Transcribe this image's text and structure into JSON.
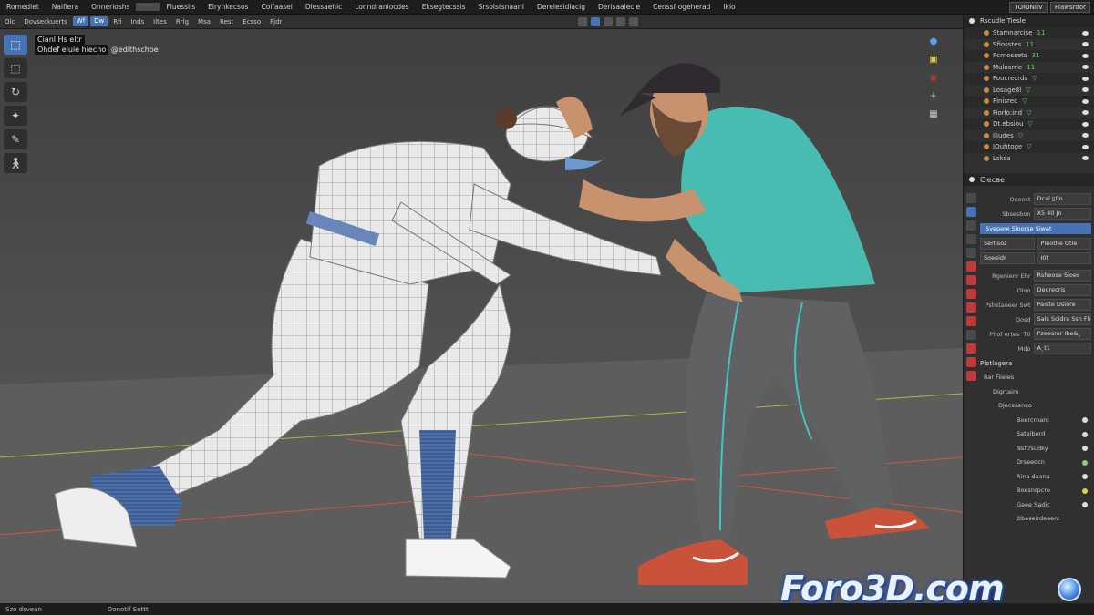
{
  "menu": {
    "items": [
      "Romedlet",
      "Nalfiera",
      "Onnerioshs",
      "",
      "Fluesslis",
      "Elrynkecsos",
      "Colfaasel",
      "Diessaehic",
      "Lonndraniocdes",
      "Eksegtecssis",
      "Srsolstsnaarll",
      "Derelesidlacig",
      "Derisaalecle",
      "Censsf ogeherad",
      "Ikio"
    ],
    "active_index": 3,
    "right_field_1": "TOIONIIV",
    "right_field_2": "Plawsrdor"
  },
  "header": {
    "items": [
      "Olc",
      "Dovseckuerts",
      "Rfi",
      "Inds",
      "Iltes",
      "Rrlg",
      "Msa",
      "Rest",
      "Ecsso",
      "Fjdr"
    ],
    "pills": [
      "Wf",
      "Dw"
    ]
  },
  "viewport": {
    "info_line1": "Cianl Hs eltr",
    "info_line2": "Ohdef eluie hiecho",
    "info_line2_suffix": "@edithschoe"
  },
  "tools": [
    "cursor",
    "select-box",
    "rotate",
    "transform",
    "annotate",
    "pose"
  ],
  "outliner": {
    "header": "Rscudle Tiesle",
    "rows": [
      {
        "label": "Stamnarcise",
        "badge": "11"
      },
      {
        "label": "Sfiosstes",
        "badge": "11"
      },
      {
        "label": "Pcrnossets",
        "badge": "31"
      },
      {
        "label": "Mulosrrie",
        "badge": "11"
      },
      {
        "label": "Foucrecrds",
        "badge": "▽"
      },
      {
        "label": "Losage8l",
        "badge": "▽"
      },
      {
        "label": "Pinisred",
        "badge": "▽"
      },
      {
        "label": "Fiorlo:ind",
        "badge": "▽"
      },
      {
        "label": "Dt.ebsiou",
        "badge": "▽"
      },
      {
        "label": "Iliudes",
        "badge": "▽"
      },
      {
        "label": "IOuhtoge",
        "badge": "▽"
      },
      {
        "label": "Lsksa",
        "badge": ""
      }
    ]
  },
  "properties": {
    "header": "Clecae",
    "rows": [
      {
        "label": "Oeoost",
        "value": "Dcal ▯0n"
      },
      {
        "label": "Sbsesbon",
        "value": "X5 40 Jn"
      }
    ],
    "active_bar": "Svepere Sloorse Siwet",
    "rows2": [
      {
        "label": "Serhsoz",
        "value": "Pleothe Gtle"
      },
      {
        "label": "Soeeidr",
        "value": "I0t"
      }
    ],
    "rows3": [
      {
        "label": "Rgenienr Ehr",
        "value": "Rsheose Sioes"
      },
      {
        "label": "Oloo",
        "value": "Deorecris"
      },
      {
        "label": "Pshstaoeer Swt",
        "value": "Paiste Dsiore"
      },
      {
        "label": "Dosd",
        "value": "Sals Scidra Ssh Flo"
      },
      {
        "label": "Phof ertes  T0",
        "value": "Pzeesrer Ibe&¸"
      },
      {
        "label": "Mdo",
        "value": "A¸t1"
      }
    ],
    "section1": "Plotlagera",
    "tree_head": [
      "Rar Fiieles",
      "Digrtairo",
      "Djecssenco"
    ],
    "tree": [
      "Boercrnaro",
      "Sateiberd",
      "Nsftrsudky",
      "Drseedcn",
      "Rina daana",
      "Boesnrpcro",
      "Gaee Sadic",
      "Obeseirdeaerc"
    ]
  },
  "status": {
    "left": "Szo dsvean",
    "mid": "Donotif Snttt"
  },
  "watermark": "Foro3D.com"
}
